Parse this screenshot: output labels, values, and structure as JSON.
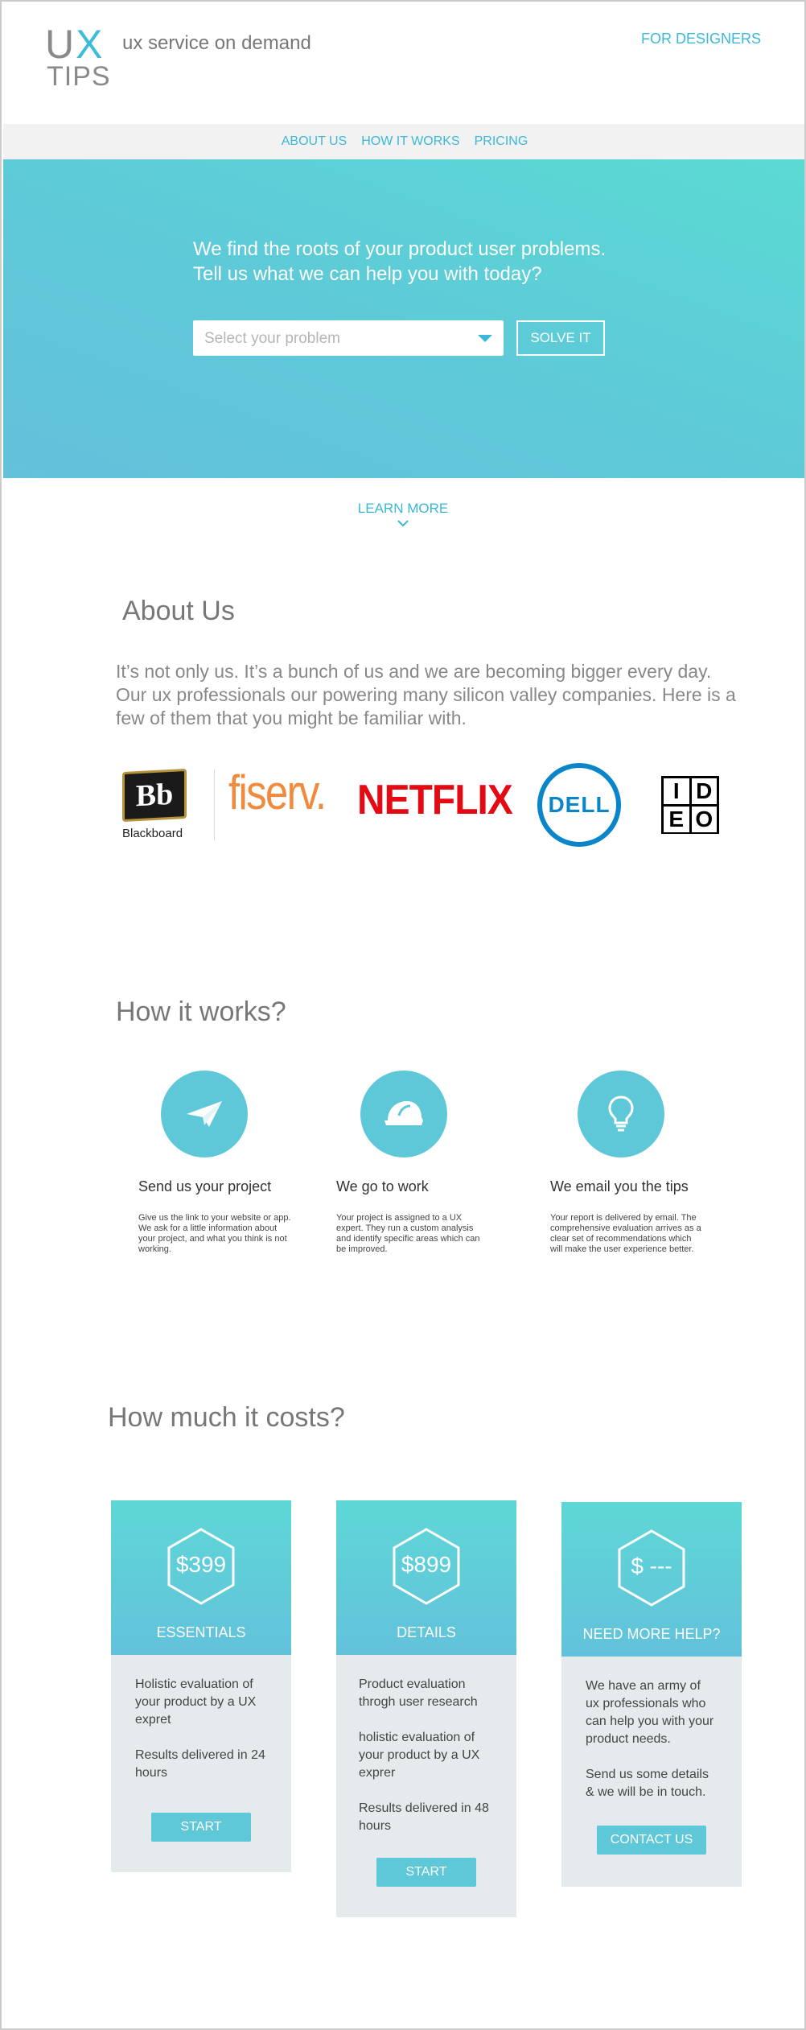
{
  "header": {
    "logo_ux": "UX",
    "logo_tips": "TIPS",
    "tagline": "ux service on demand",
    "for_designers": "FOR DESIGNERS"
  },
  "nav": {
    "items": [
      {
        "label": "ABOUT US"
      },
      {
        "label": "HOW IT WORKS"
      },
      {
        "label": "PRICING"
      }
    ]
  },
  "hero": {
    "line1": "We find the roots of your product user problems.",
    "line2": "Tell us what we can help you with today?",
    "select_placeholder": "Select your problem",
    "solve_label": "SOLVE IT"
  },
  "learn_more": "LEARN MORE",
  "about": {
    "title": "About Us",
    "text": "It’s not only us. It’s a bunch of us and we are becoming bigger every day. Our ux professionals our powering many silicon valley companies. Here is a few of them that you might be familiar with.",
    "logos": {
      "blackboard_mark": "Bb",
      "blackboard_name": "Blackboard",
      "fiserv": "fiserv.",
      "netflix": "NETFLIX",
      "dell": "DELL",
      "ideo_letters": [
        "I",
        "D",
        "E",
        "O"
      ]
    }
  },
  "how": {
    "title": "How it works?",
    "steps": [
      {
        "icon": "paper-plane-icon",
        "title": "Send us your project",
        "desc": "Give us the link to your website or app. We ask for a little information about your project, and what you think is not working."
      },
      {
        "icon": "hard-hat-icon",
        "title": "We go to work",
        "desc": "Your project is assigned to a UX expert. They run a custom analysis and identify specific areas which can be improved."
      },
      {
        "icon": "lightbulb-icon",
        "title": "We email you the tips",
        "desc": "Your report is delivered by email. The comprehensive evaluation arrives as a clear set of recommendations which will make the user experience better."
      }
    ]
  },
  "pricing": {
    "title": "How much it costs?",
    "plans": [
      {
        "price": "$399",
        "name": "ESSENTIALS",
        "lines": [
          "Holistic evaluation of your product by a UX expret",
          "Results delivered in 24 hours"
        ],
        "button": "START"
      },
      {
        "price": "$899",
        "name": "DETAILS",
        "lines": [
          "Product evaluation throgh user research",
          "holistic evaluation of your product by a UX exprer",
          "Results delivered in 48 hours"
        ],
        "button": "START"
      },
      {
        "price": "$ ---",
        "name": "NEED MORE HELP?",
        "lines": [
          "We have an army of ux professionals who can help you with your product needs.",
          "Send us some details & we will be in touch."
        ],
        "button": "CONTACT US"
      }
    ]
  },
  "colors": {
    "accent": "#3bb8d8",
    "hero_start": "#5bdad4",
    "hero_end": "#63c1dc",
    "text_gray": "#777777",
    "nav_bg": "#f2f2f2",
    "card_bg": "#e5ebec"
  }
}
